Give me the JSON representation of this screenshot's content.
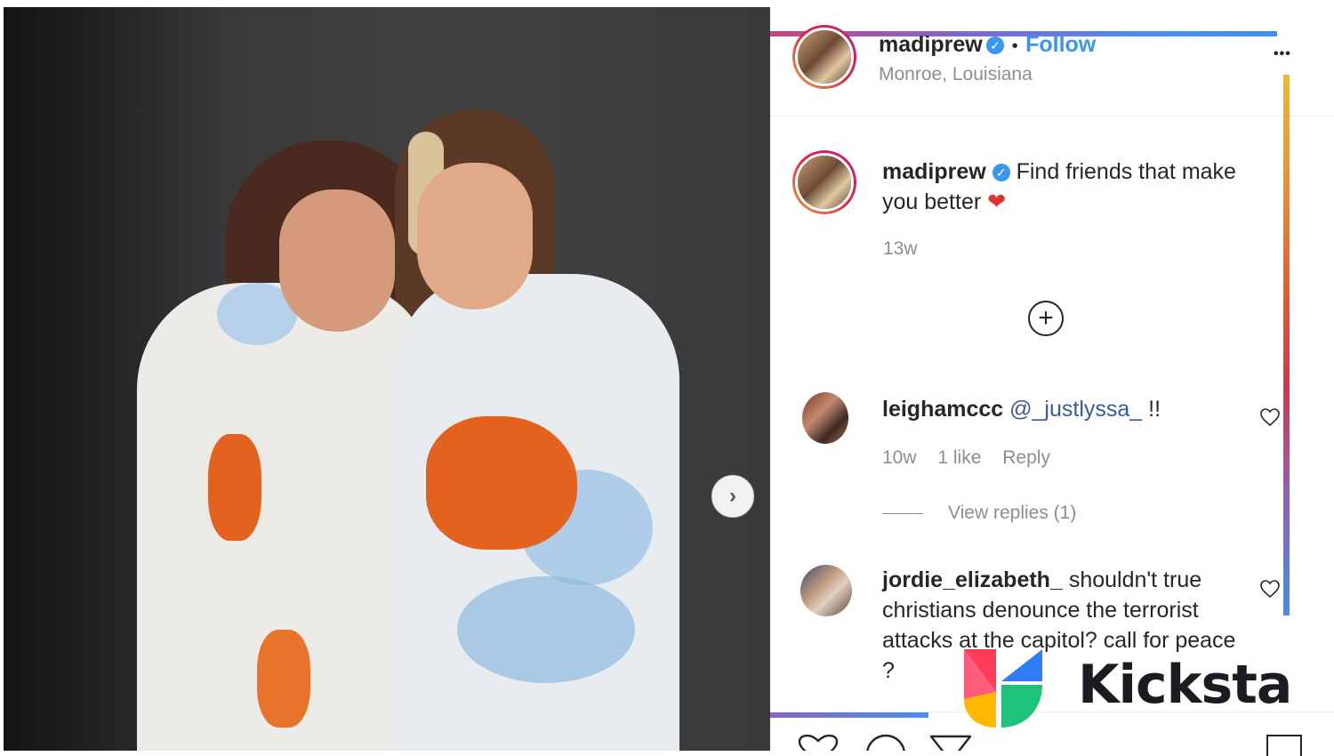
{
  "post": {
    "author": "madiprew",
    "follow_label": "Follow",
    "separator": "•",
    "location": "Monroe, Louisiana",
    "more_label": "•••",
    "next_label": "›"
  },
  "caption": {
    "username": "madiprew",
    "text": "Find friends that make you better",
    "emoji": "❤",
    "time": "13w"
  },
  "load_more_label": "+",
  "comments": [
    {
      "username": "leighamccc",
      "mention": "@_justlyssa_",
      "text": "!!",
      "time": "10w",
      "likes": "1 like",
      "reply_label": "Reply",
      "view_replies": "View replies (1)"
    },
    {
      "username": "jordie_elizabeth_",
      "text": "shouldn't true christians denounce the terrorist attacks at the capitol? call for peace ?"
    }
  ],
  "brand": {
    "name": "Kicksta",
    "colors": [
      "#ff3b5c",
      "#ffb800",
      "#1ec27a",
      "#2f7df6"
    ]
  },
  "colors": {
    "link_blue": "#3897f0",
    "meta_gray": "#8e8e8e",
    "text_dark": "#262626"
  }
}
